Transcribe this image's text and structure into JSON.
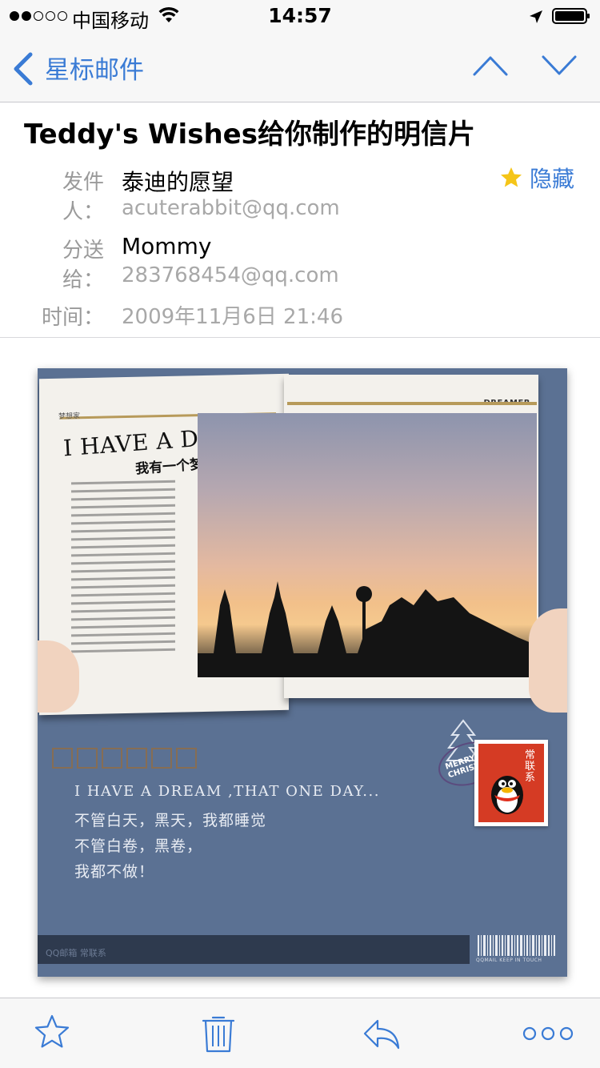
{
  "status_bar": {
    "carrier": "中国移动",
    "time": "14:57"
  },
  "nav": {
    "back_label": "星标邮件"
  },
  "email": {
    "subject": "Teddy's Wishes给你制作的明信片",
    "from_label": "发件人：",
    "from_name": "泰迪的愿望",
    "from_address": "acuterabbit@qq.com",
    "to_label": "分送给：",
    "to_name": "Mommy",
    "to_address": "283768454@qq.com",
    "time_label": "时间：",
    "time_value": "2009年11月6日 21:46",
    "hide_label": "隐藏",
    "star_color": "#f5c518",
    "accent_color": "#3a7bd5"
  },
  "postcard": {
    "magazine_tag_left": "梦想家",
    "magazine_tag_right": "DREAMER",
    "magazine_title": "I HAVE A DREAM",
    "magazine_subtitle": "我有一个梦想",
    "line1": "I HAVE A DREAM ,THAT ONE DAY...",
    "line2": "不管白天，黑天，我都睡觉",
    "line3": "不管白卷，黑卷，",
    "line4": "我都不做！",
    "postmark_text": "MERRY CHRISTMAS",
    "stamp_label": "常联系",
    "footer_text": "QQ邮箱 常联系",
    "barcode_caption": "QQMAIL KEEP IN TOUCH"
  },
  "toolbar": {
    "icons": [
      "star-icon",
      "trash-icon",
      "reply-icon",
      "more-icon"
    ]
  }
}
